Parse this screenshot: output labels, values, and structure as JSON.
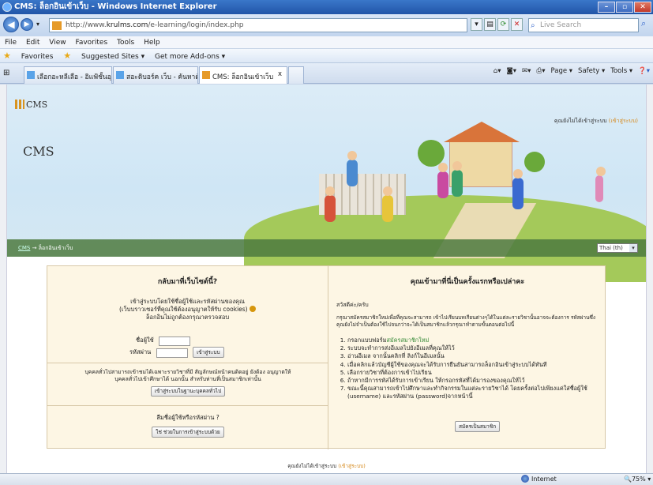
{
  "window": {
    "title": "CMS: ล็อกอินเข้าเว็บ - Windows Internet Explorer",
    "min": "–",
    "max": "▫",
    "close": "✕"
  },
  "address": {
    "url_prefix": "http://www.",
    "url_domain": "krulms.com",
    "url_path": "/e-learning/login/index.php",
    "search_placeholder": "Live Search"
  },
  "menu": [
    "File",
    "Edit",
    "View",
    "Favorites",
    "Tools",
    "Help"
  ],
  "favorites": {
    "label": "Favorites",
    "items": [
      "Suggested Sites ▾",
      "Get more Add-ons ▾"
    ]
  },
  "tabs": [
    {
      "label": "เลือกอะหลีเลือ - อิแฟ้ชั้นอุติกอ..."
    },
    {
      "label": "สอะดิบอร์ค เว็บ - ค้นหาด้วย G..."
    },
    {
      "label": "CMS: ล็อกอินเข้าเว็บ"
    }
  ],
  "commandbar": [
    "Page ▾",
    "Safety ▾",
    "Tools ▾"
  ],
  "site": {
    "logo": "CMS",
    "name": "CMS",
    "loginstate_text": "คุณยังไม่ได้เข้าสู่ระบบ",
    "loginstate_link": "(เข้าสู่ระบบ)",
    "breadcrumb_home": "CMS",
    "breadcrumb_sep": "→",
    "breadcrumb_current": "ล็อกอินเข้าเว็บ",
    "language": "Thai (th)"
  },
  "login": {
    "title": "กลับมาที่เว็บไซต์นี้?",
    "subtitle1": "เข้าสู่ระบบโดยใช้ชื่อผู้ใช้และรหัสผ่านของคุณ",
    "subtitle2": "(เว็บบราวเซอร์ที่คุณใช้ต้องอนุญาตให้รับ cookies)",
    "subtitle3": "ล็อกอินไม่ถูกต้องกรุณาตรวจสอบ",
    "username_label": "ชื่อผู้ใช้",
    "password_label": "รหัสผ่าน",
    "login_button": "เข้าสู่ระบบ",
    "guest_text1": "บุคคลทั่วไปสามารถเข้าชมได้เฉพาะรายวิชาที่มี สัญลักษณ์หน้าคนติดอยู่ ยังต้อง อนุญาตให้",
    "guest_text2": "บุคคลทั่วไปเข้าศึกษาได้ นอกนั้น สำหรับท่านที่เป็นสมาชิกเท่านั้น",
    "guest_button": "เข้าสู่ระบบในฐานะบุคคลทั่วไป",
    "forgot_title": "ลืมชื่อผู้ใช้หรือรหัสผ่าน ?",
    "forgot_button": "ใช่ ช่วยในการเข้าสู่ระบบด้วย"
  },
  "signup": {
    "title": "คุณเข้ามาที่นี่เป็นครั้งแรกหรือเปล่าคะ",
    "greeting": "สวัสดีค่ะ/ครับ",
    "intro": "กรุณาสมัครสมาชิกใหม่เพื่อที่คุณจะสามารถ เข้าไปเรียนบทเรียนต่างๆได้ในแต่ละรายวิชานั้นอาจจะต้องการ รหัสผ่านซึ่งคุณยังไม่จำเป็นต้องใช้ไปจนกว่าจะได้เป็นสมาชิกแล้วกรุณาทำตามขั้นตอนต่อไปนี้",
    "steps": [
      {
        "pre": "กรอกแบบฟอร์ม",
        "link": "สมัครสมาชิกใหม่"
      },
      {
        "pre": "ระบบจะทำการส่งอีเมลไปยังอีเมลที่คุณให้ไว้",
        "link": ""
      },
      {
        "pre": "อ่านอีเมล จากนั้นคลิกที่ ลิงก์ในอีเมลนั้น",
        "link": ""
      },
      {
        "pre": "เมื่อคลิกแล้วบัญชีผู้ใช้ของคุณจะได้รับการยืนยันสามารถล็อกอินเข้าสู่ระบบได้ทันที",
        "link": ""
      },
      {
        "pre": "เลือกรายวิชาที่ต้องการเข้าไปเรียน",
        "link": ""
      },
      {
        "pre": "ถ้าหากมีการรหัสได้รับการเข้าเรียน ให้กรอกรหัสที่ได้มารองของคุณให้ไว้",
        "link": ""
      },
      {
        "pre": "ขณะนี้คุณสามารถเข้าไปศึกษาและทำกิจกรรมในแต่ละรายวิชาได้ โดยครั้งต่อไปเพียงแค่ใส่ชื่อผู้ใช้ (username) และรหัสผ่าน (password)จากหน้านี้",
        "link": ""
      }
    ],
    "button": "สมัครเป็นสมาชิก"
  },
  "footer": {
    "text": "คุณยังไม่ได้เข้าสู่ระบบ",
    "link": "(เข้าสู่ระบบ)"
  },
  "status": {
    "zone": "Internet",
    "zoom": "75%"
  }
}
